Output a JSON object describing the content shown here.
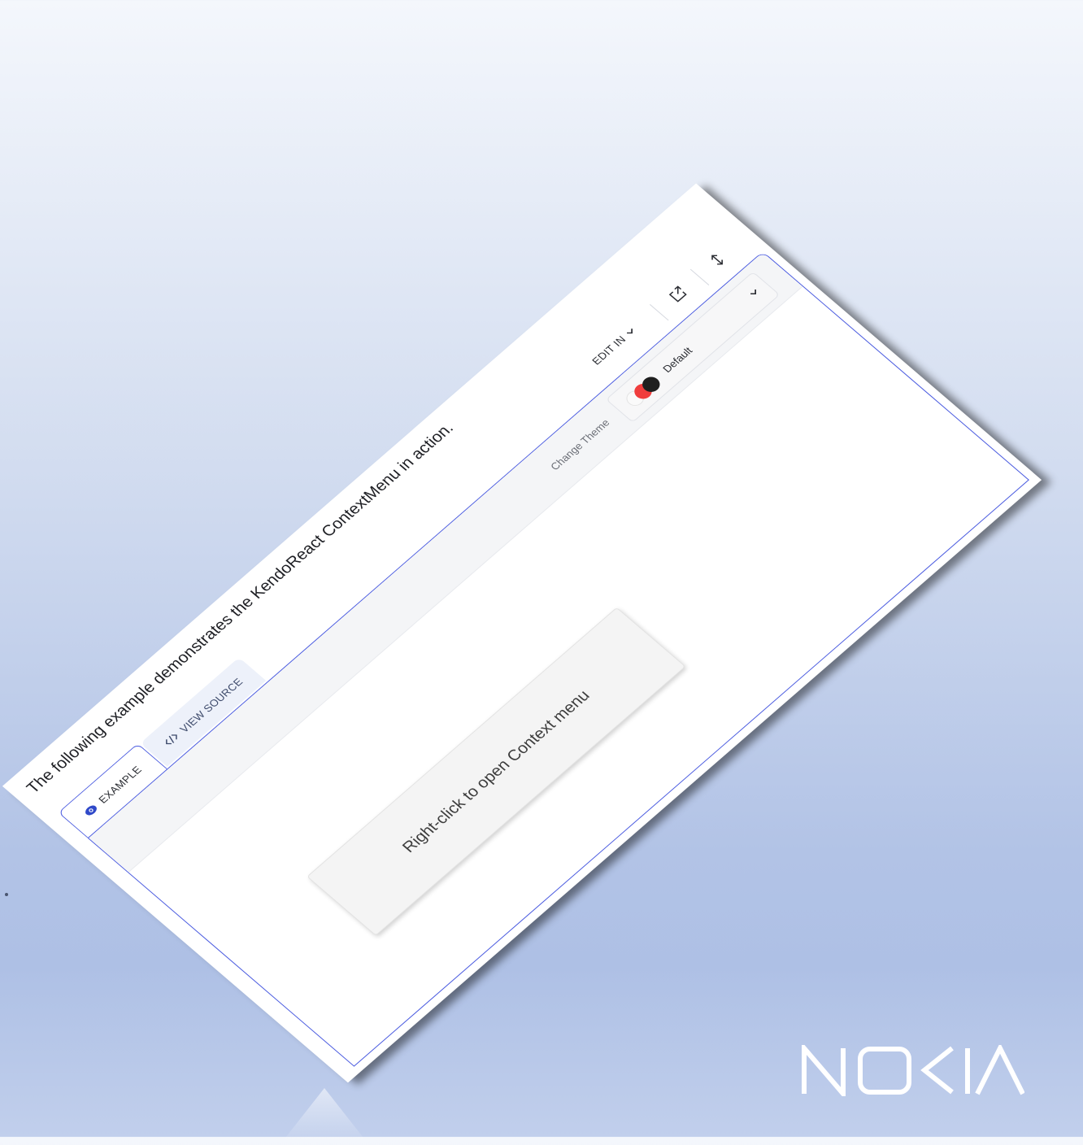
{
  "description": "The following example demonstrates the KendoReact ContextMenu in action.",
  "tabs": [
    {
      "label": "EXAMPLE",
      "icon": "eye-icon",
      "active": true
    },
    {
      "label": "VIEW SOURCE",
      "icon": "code-icon",
      "active": false
    }
  ],
  "header_actions": {
    "edit_in_label": "EDIT IN",
    "edit_in_icon": "chevron-down-icon",
    "share_icon": "open-external-icon",
    "expand_icon": "expand-vertical-icon"
  },
  "toolbar": {
    "change_theme_label": "Change Theme",
    "theme_value": "Default",
    "theme_swatch_colors": [
      "#fafafa",
      "#f03d3d",
      "#1f1f1f"
    ]
  },
  "demo": {
    "context_target_text": "Right-click to open Context menu"
  },
  "colors": {
    "accent_border": "#4a5be0",
    "inactive_tab_bg": "#edf1fa"
  },
  "brand_logo": "NOKIA"
}
